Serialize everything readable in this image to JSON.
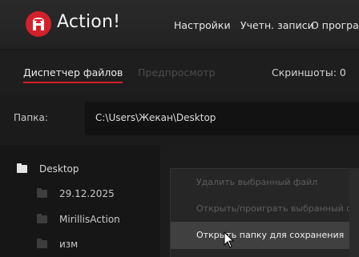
{
  "app": {
    "title": "Action!"
  },
  "topnav": {
    "settings": "Настройки",
    "accounts": "Учетн. записи",
    "about": "О програ"
  },
  "tabs": {
    "files": "Диспетчер файлов",
    "preview": "Предпросмотр",
    "screenshots": "Скриншоты: 0"
  },
  "folder": {
    "label": "Папка:",
    "path": "C:\\Users\\Жекан\\Desktop"
  },
  "tree": {
    "root": "Desktop",
    "children": [
      "29.12.2025",
      "MirillisAction",
      "изм"
    ]
  },
  "context_menu": {
    "items": [
      "Удалить выбранный файл",
      "Открыть/проиграть выбранный файл",
      "Открыть папку для сохранения"
    ]
  },
  "colors": {
    "accent": "#d3212c",
    "background": "#1b1b1b",
    "header": "#252525",
    "menu_active": "#404040"
  },
  "icons": [
    "action-logo-icon",
    "folder-icon",
    "mouse-cursor-icon"
  ]
}
